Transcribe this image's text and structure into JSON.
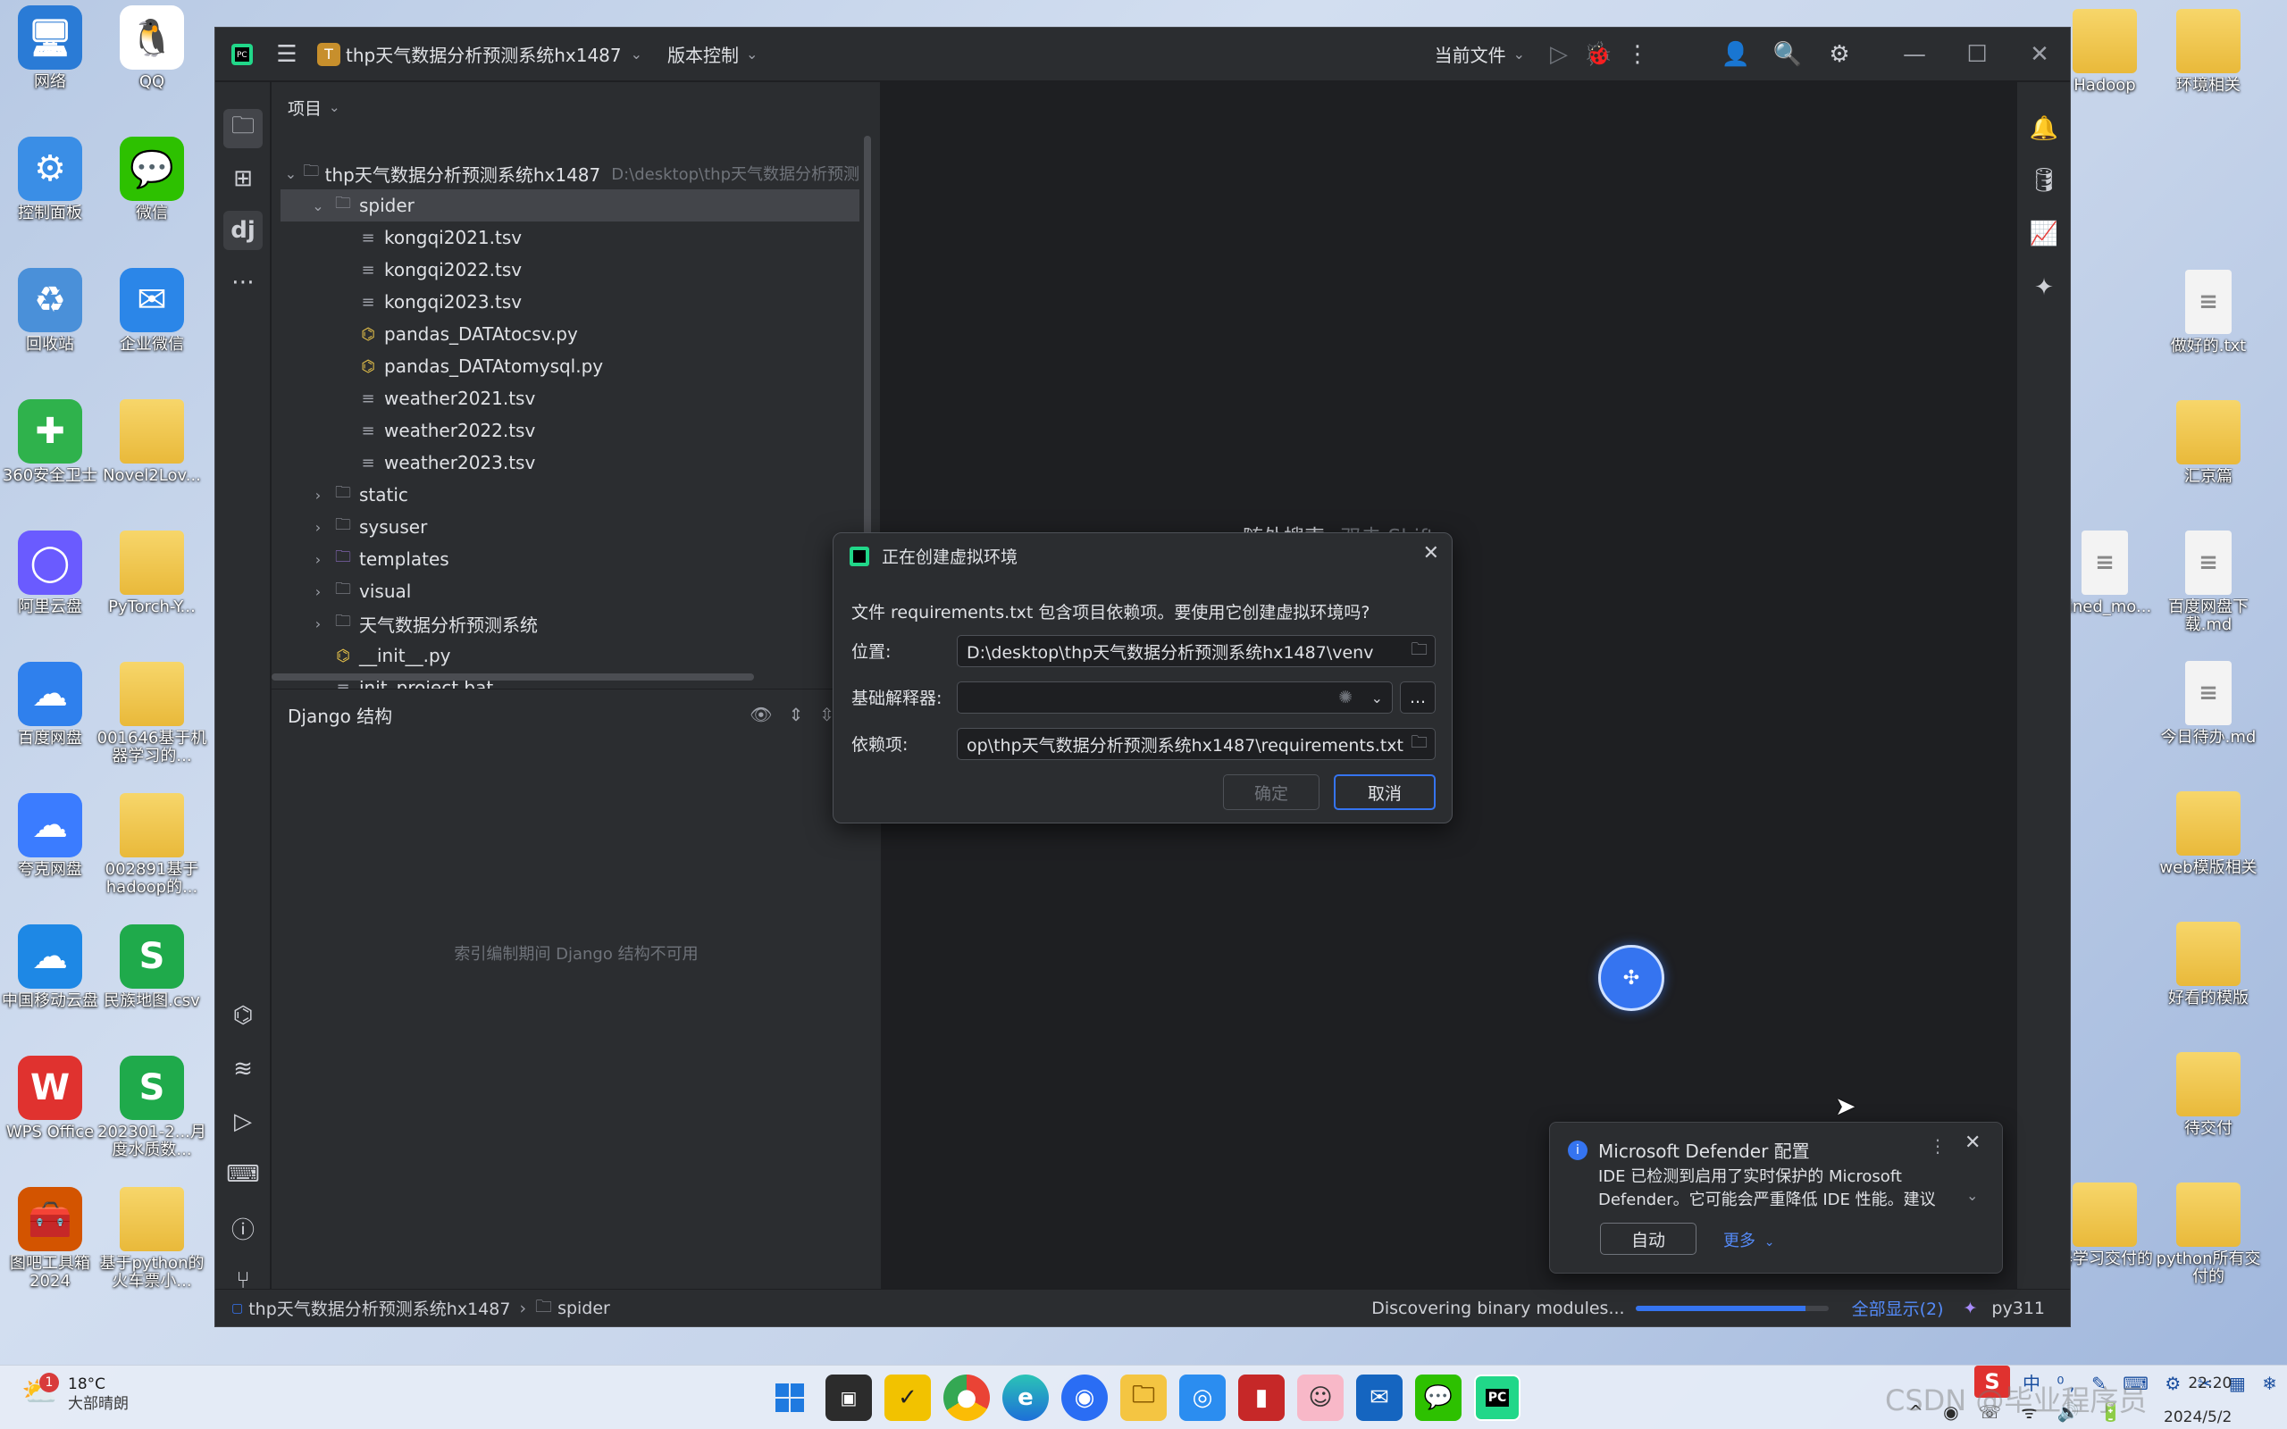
{
  "desktop": {
    "left_icons": [
      {
        "label": "网络",
        "glyph": "🖥",
        "color": "#2a7bd6"
      },
      {
        "label": "QQ",
        "glyph": "🐧",
        "color": "#ffffff"
      },
      {
        "label": "控制面板",
        "glyph": "⚙",
        "color": "#3a8ee6"
      },
      {
        "label": "微信",
        "glyph": "💬",
        "color": "#2dc100"
      },
      {
        "label": "回收站",
        "glyph": "♻",
        "color": "#4a90d9"
      },
      {
        "label": "企业微信",
        "glyph": "✉",
        "color": "#2b86e8"
      },
      {
        "label": "360安全卫士",
        "glyph": "✚",
        "color": "#2fb24c"
      },
      {
        "label": "Novel2Lov...",
        "glyph": "",
        "color": "folder"
      },
      {
        "label": "阿里云盘",
        "glyph": "◯",
        "color": "#6a5bff"
      },
      {
        "label": "PyTorch-Y...",
        "glyph": "",
        "color": "folder"
      },
      {
        "label": "百度网盘",
        "glyph": "☁",
        "color": "#2f80ed"
      },
      {
        "label": "001646基于机器学习的...",
        "glyph": "",
        "color": "folder"
      },
      {
        "label": "夸克网盘",
        "glyph": "☁",
        "color": "#3b7cff"
      },
      {
        "label": "002891基于hadoop的...",
        "glyph": "",
        "color": "folder"
      },
      {
        "label": "中国移动云盘",
        "glyph": "☁",
        "color": "#1e88e5"
      },
      {
        "label": "民族地图.csv",
        "glyph": "S",
        "color": "#1faa4b"
      },
      {
        "label": "WPS Office",
        "glyph": "W",
        "color": "#e0322f"
      },
      {
        "label": "202301-2...月度水质数...",
        "glyph": "S",
        "color": "#1faa4b"
      },
      {
        "label": "图吧工具箱2024",
        "glyph": "🧰",
        "color": "#d35400"
      },
      {
        "label": "基于python的火车票小...",
        "glyph": "",
        "color": "folder"
      }
    ],
    "right_icons": [
      {
        "label": "Hadoop",
        "type": "folder"
      },
      {
        "label": "环境相关",
        "type": "folder"
      },
      {
        "label": "做好的.txt",
        "type": "doc"
      },
      {
        "label": "汇京篇",
        "type": "folder"
      },
      {
        "label": "ained_mo...",
        "type": "doc"
      },
      {
        "label": "百度网盘下载.md",
        "type": "doc"
      },
      {
        "label": "今日待办.md",
        "type": "doc"
      },
      {
        "label": "web模版相关",
        "type": "folder"
      },
      {
        "label": "好看的模版",
        "type": "folder"
      },
      {
        "label": "待交付",
        "type": "folder"
      },
      {
        "label": "器学习交付的",
        "type": "folder"
      },
      {
        "label": "python所有交付的",
        "type": "folder"
      }
    ]
  },
  "ide": {
    "project_badge": "T",
    "project_name": "thp天气数据分析预测系统hx1487",
    "vcs_label": "版本控制",
    "run_config": "当前文件",
    "project_panel_title": "项目",
    "tree": [
      {
        "level": 0,
        "arrow": "⌄",
        "icon": "folder",
        "name": "thp天气数据分析预测系统hx1487",
        "hint": "D:\\desktop\\thp天气数据分析预测"
      },
      {
        "level": 1,
        "arrow": "⌄",
        "icon": "folder",
        "name": "spider",
        "selected": true
      },
      {
        "level": 2,
        "arrow": "",
        "icon": "file",
        "name": "kongqi2021.tsv"
      },
      {
        "level": 2,
        "arrow": "",
        "icon": "file",
        "name": "kongqi2022.tsv"
      },
      {
        "level": 2,
        "arrow": "",
        "icon": "file",
        "name": "kongqi2023.tsv"
      },
      {
        "level": 2,
        "arrow": "",
        "icon": "py",
        "name": "pandas_DATAtocsv.py"
      },
      {
        "level": 2,
        "arrow": "",
        "icon": "py",
        "name": "pandas_DATAtomysql.py"
      },
      {
        "level": 2,
        "arrow": "",
        "icon": "file",
        "name": "weather2021.tsv"
      },
      {
        "level": 2,
        "arrow": "",
        "icon": "file",
        "name": "weather2022.tsv"
      },
      {
        "level": 2,
        "arrow": "",
        "icon": "file",
        "name": "weather2023.tsv"
      },
      {
        "level": 1,
        "arrow": "›",
        "icon": "folder",
        "name": "static"
      },
      {
        "level": 1,
        "arrow": "›",
        "icon": "folder",
        "name": "sysuser"
      },
      {
        "level": 1,
        "arrow": "›",
        "icon": "folder-purple",
        "name": "templates"
      },
      {
        "level": 1,
        "arrow": "›",
        "icon": "folder",
        "name": "visual"
      },
      {
        "level": 1,
        "arrow": "›",
        "icon": "folder",
        "name": "天气数据分析预测系统"
      },
      {
        "level": 1,
        "arrow": "",
        "icon": "py",
        "name": "__init__.py"
      },
      {
        "level": 1,
        "arrow": "",
        "icon": "file",
        "name": "init_project.bat"
      }
    ],
    "django_panel_title": "Django 结构",
    "django_unavailable": "索引编制期间 Django 结构不可用",
    "editor_hint_main": "随处搜索",
    "editor_hint_key": "双击 Shift",
    "status": {
      "breadcrumb_project": "thp天气数据分析预测系统hx1487",
      "breadcrumb_folder": "spider",
      "task": "Discovering binary modules...",
      "progress": 0.88,
      "show_all": "全部显示(2)",
      "interpreter": "py311"
    }
  },
  "dialog": {
    "title": "正在创建虚拟环境",
    "message": "文件 requirements.txt 包含项目依赖项。要使用它创建虚拟环境吗?",
    "location_label": "位置:",
    "location_value": "D:\\desktop\\thp天气数据分析预测系统hx1487\\venv",
    "interpreter_label": "基础解释器:",
    "interpreter_value": "",
    "deps_label": "依赖项:",
    "deps_value": "op\\thp天气数据分析预测系统hx1487\\requirements.txt",
    "browse_label": "...",
    "ok_label": "确定",
    "cancel_label": "取消"
  },
  "notification": {
    "title": "Microsoft Defender 配置",
    "body": "IDE 已检测到启用了实时保护的 Microsoft Defender。它可能会严重降低 IDE 性能。建议",
    "auto_button": "自动",
    "more_link": "更多"
  },
  "taskbar": {
    "weather_temp": "18°C",
    "weather_desc": "大部晴朗",
    "weather_badge": "1",
    "time": "22:20",
    "date": "2024/5/2",
    "watermark": "CSDN @毕业程序员"
  },
  "colors": {
    "accent": "#3574f0",
    "ide_bg": "#1e1f22",
    "panel_bg": "#2b2d30"
  }
}
